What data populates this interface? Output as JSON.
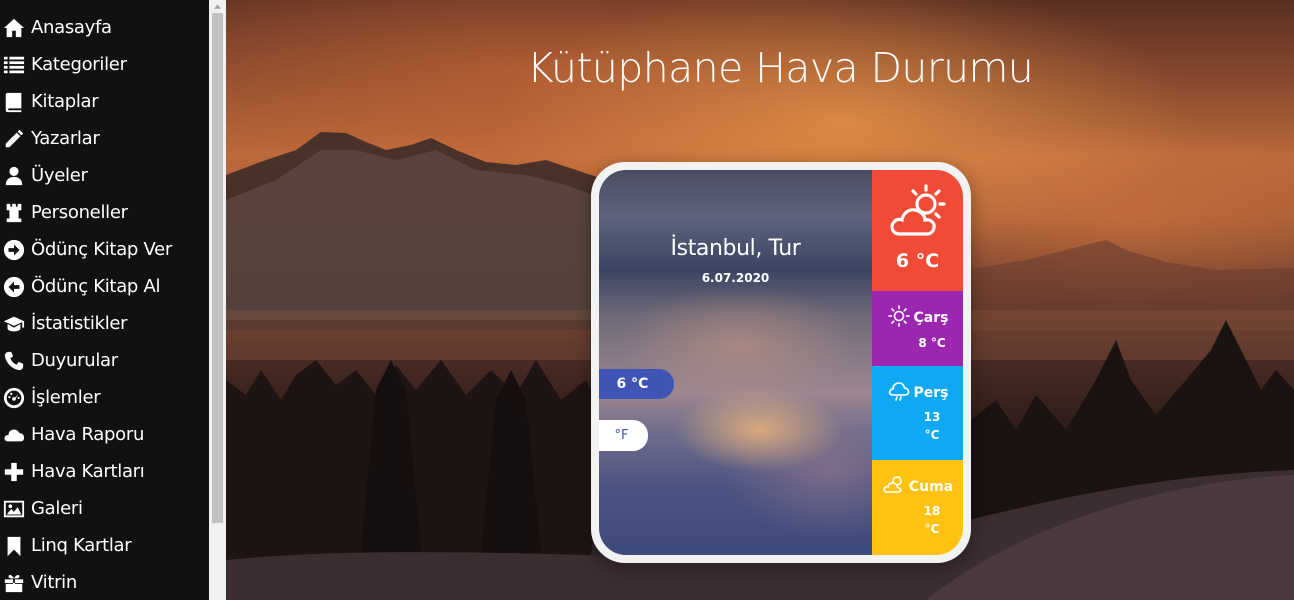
{
  "sidebar": {
    "items": [
      {
        "label": "Anasayfa",
        "icon": "home-icon"
      },
      {
        "label": "Kategoriler",
        "icon": "list-icon"
      },
      {
        "label": "Kitaplar",
        "icon": "book-icon"
      },
      {
        "label": "Yazarlar",
        "icon": "pencil-icon"
      },
      {
        "label": "Üyeler",
        "icon": "user-icon"
      },
      {
        "label": "Personeller",
        "icon": "tower-icon"
      },
      {
        "label": "Ödünç Kitap Ver",
        "icon": "arrow-right-circle-icon"
      },
      {
        "label": "Ödünç Kitap Al",
        "icon": "arrow-left-circle-icon"
      },
      {
        "label": "İstatistikler",
        "icon": "graduation-cap-icon"
      },
      {
        "label": "Duyurular",
        "icon": "phone-icon"
      },
      {
        "label": "İşlemler",
        "icon": "dashboard-icon"
      },
      {
        "label": "Hava Raporu",
        "icon": "cloud-icon"
      },
      {
        "label": "Hava Kartları",
        "icon": "plus-icon"
      },
      {
        "label": "Galeri",
        "icon": "image-icon"
      },
      {
        "label": "Linq Kartlar",
        "icon": "bookmark-icon"
      },
      {
        "label": "Vitrin",
        "icon": "gift-icon"
      }
    ]
  },
  "main": {
    "title": "Kütüphane Hava Durumu"
  },
  "weather": {
    "city": "İstanbul, Tur",
    "date": "6.07.2020",
    "unit_c": "6 °C",
    "unit_f": "°F",
    "today": {
      "temp": "6 °C",
      "icon": "partly-sunny-cloud-icon",
      "color": "#f04b37"
    },
    "forecast": [
      {
        "day": "Çarş",
        "temp": "8 °C",
        "icon": "sun-icon",
        "color": "#9b27b0"
      },
      {
        "day": "Perş",
        "temp_value": "13",
        "temp_unit": "°C",
        "icon": "rain-cloud-icon",
        "color": "#0fa8f2"
      },
      {
        "day": "Cuma",
        "temp_value": "18",
        "temp_unit": "°C",
        "icon": "partly-cloudy-icon",
        "color": "#ffc210"
      }
    ]
  }
}
